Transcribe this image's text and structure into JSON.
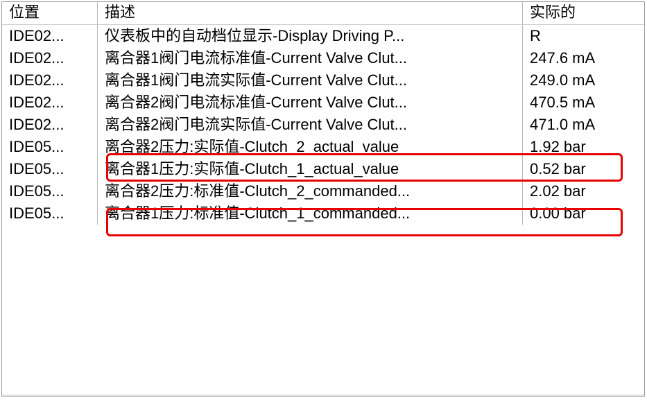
{
  "header": {
    "position": "位置",
    "description": "描述",
    "actual": "实际的"
  },
  "rows": [
    {
      "pos": "IDE02...",
      "desc": "仪表板中的自动档位显示-Display Driving P...",
      "val": "R"
    },
    {
      "pos": "IDE02...",
      "desc": "离合器1阀门电流标准值-Current Valve Clut...",
      "val": "247.6 mA"
    },
    {
      "pos": "IDE02...",
      "desc": "离合器1阀门电流实际值-Current Valve Clut...",
      "val": "249.0 mA"
    },
    {
      "pos": "IDE02...",
      "desc": "离合器2阀门电流标准值-Current Valve Clut...",
      "val": "470.5 mA"
    },
    {
      "pos": "IDE02...",
      "desc": "离合器2阀门电流实际值-Current Valve Clut...",
      "val": "471.0 mA"
    },
    {
      "pos": "IDE05...",
      "desc": "离合器2压力:实际值-Clutch_2_actual_value",
      "val": "1.92 bar"
    },
    {
      "pos": "IDE05...",
      "desc": "离合器1压力:实际值-Clutch_1_actual_value",
      "val": "0.52 bar"
    },
    {
      "pos": "IDE05...",
      "desc": "离合器2压力:标准值-Clutch_2_commanded...",
      "val": "2.02 bar"
    },
    {
      "pos": "IDE05...",
      "desc": "离合器1压力:标准值-Clutch_1_commanded...",
      "val": "0.00 bar"
    }
  ]
}
